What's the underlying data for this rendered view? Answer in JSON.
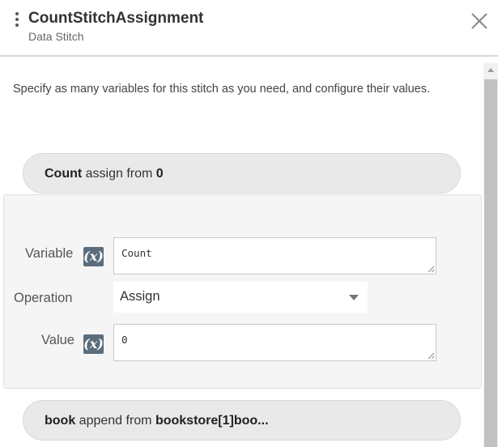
{
  "header": {
    "title": "CountStitchAssignment",
    "subtitle": "Data Stitch"
  },
  "description": "Specify as many variables for this stitch as you need, and configure their values.",
  "stitches": [
    {
      "var": "Count",
      "op": " assign from ",
      "src": "0"
    },
    {
      "var": "book",
      "op": " append from ",
      "src": "bookstore[1]boo..."
    }
  ],
  "form": {
    "variable_label": "Variable",
    "variable_value": "Count",
    "operation_label": "Operation",
    "operation_value": "Assign",
    "value_label": "Value",
    "value_value": "0",
    "variable_icon": "x-variable-icon",
    "x_glyph": "(x)"
  }
}
